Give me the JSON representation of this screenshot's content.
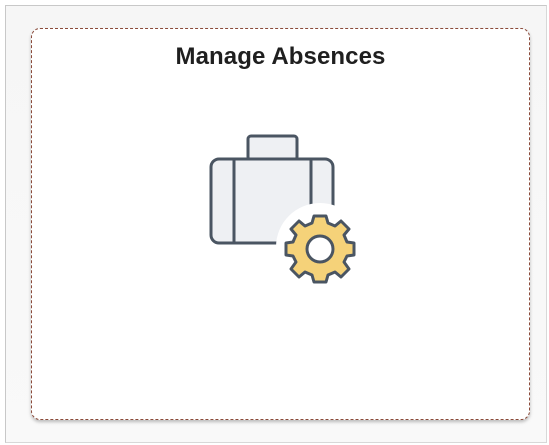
{
  "tile": {
    "title": "Manage Absences",
    "icon": "briefcase-gear-icon"
  },
  "colors": {
    "tile_border": "#8a4a3a",
    "briefcase_fill": "#eef0f3",
    "briefcase_stroke": "#4a5562",
    "gear_fill": "#f5d279",
    "title_text": "#1f1f1f"
  }
}
